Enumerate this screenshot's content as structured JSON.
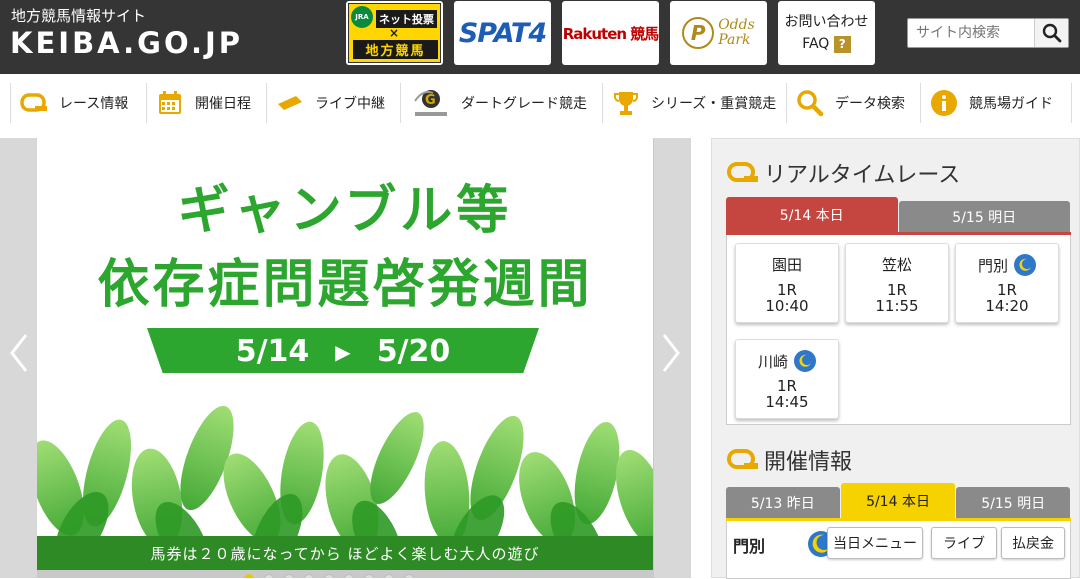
{
  "header": {
    "site_subtitle": "地方競馬情報サイト",
    "site_logo": "KEIBA.GO.JP",
    "jra_circle": "JRA",
    "jra_net": "ネット投票",
    "jra_x": "×",
    "jra_chiho": "地方競馬",
    "spat4": "SPAT4",
    "rakuten": "Rakuten 競馬",
    "odds_p": "P",
    "odds_line1": "Odds",
    "odds_line2": "Park",
    "faq_line1": "お問い合わせ",
    "faq_line2": "FAQ",
    "faq_q": "?",
    "search_placeholder": "サイト内検索"
  },
  "nav": [
    {
      "label": "レース情報"
    },
    {
      "label": "開催日程"
    },
    {
      "label": "ライブ中継"
    },
    {
      "label": "ダートグレード競走"
    },
    {
      "label": "シリーズ・重賞競走"
    },
    {
      "label": "データ検索"
    },
    {
      "label": "競馬場ガイド"
    }
  ],
  "banner": {
    "title_line1": "ギャンブル等",
    "title_line2": "依存症問題啓発週間",
    "date_from": "5/14",
    "arrow": "▶",
    "date_to": "5/20",
    "footer": "馬券は２０歳になってから ほどよく楽しむ大人の遊び",
    "prev": "‹",
    "next": "›",
    "dot_count": 9,
    "active_dot": 0
  },
  "realtime": {
    "title": "リアルタイムレース",
    "tab_today": "5/14 本日",
    "tab_tomorrow": "5/15 明日",
    "races": [
      {
        "track": "園田",
        "race": "1R",
        "time": "10:40",
        "night": false
      },
      {
        "track": "笠松",
        "race": "1R",
        "time": "11:55",
        "night": false
      },
      {
        "track": "門別",
        "race": "1R",
        "time": "14:20",
        "night": true
      },
      {
        "track": "川崎",
        "race": "1R",
        "time": "14:45",
        "night": true
      }
    ]
  },
  "kaisai": {
    "title": "開催情報",
    "tab_yesterday": "5/13 昨日",
    "tab_today": "5/14 本日",
    "tab_tomorrow": "5/15 明日",
    "track": "門別",
    "btn_menu": "当日メニュー",
    "btn_live": "ライブ",
    "btn_payout": "払戻金"
  },
  "colors": {
    "header_bg": "#353535",
    "accent_yellow": "#f6d200",
    "tab_red": "#c54640",
    "banner_green": "#2da62f",
    "night_blue": "#2f77c9"
  }
}
